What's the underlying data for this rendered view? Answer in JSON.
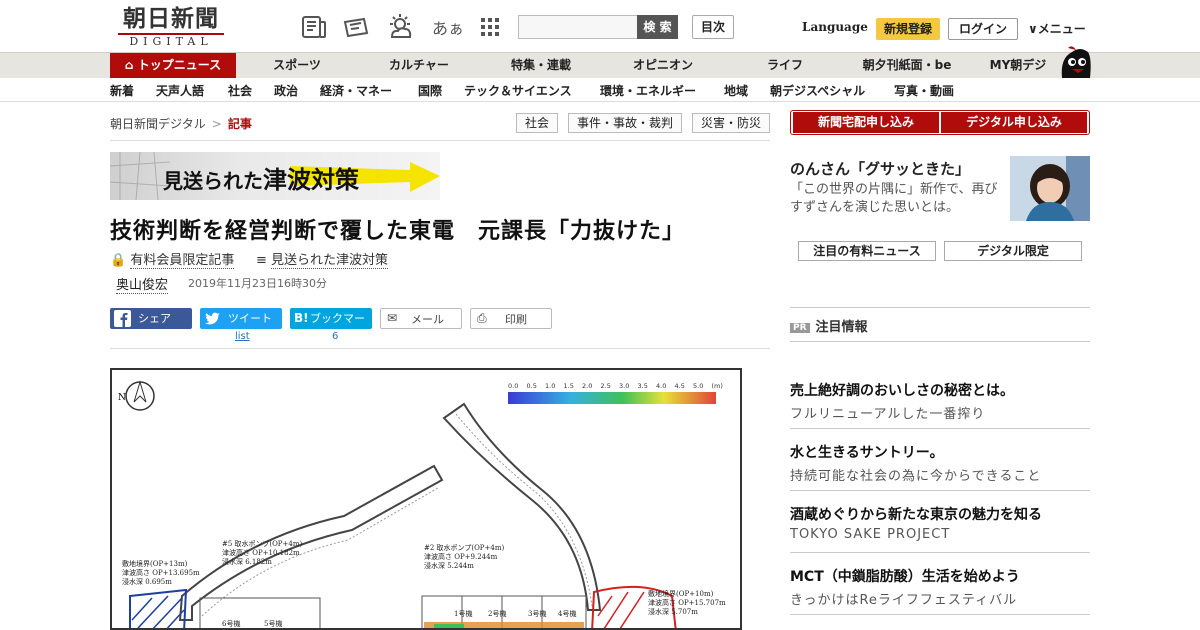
{
  "header": {
    "logo_jp": "朝日新聞",
    "logo_en": "DIGITAL",
    "font_toggle": "あぁ",
    "search_placeholder": "",
    "search_label": "検 索",
    "index_label": "目次",
    "language_label": "Language",
    "register_label": "新規登録",
    "login_label": "ログイン",
    "menu_label": "メニュー"
  },
  "nav_primary": [
    "トップニュース",
    "スポーツ",
    "カルチャー",
    "特集・連載",
    "オピニオン",
    "ライフ",
    "朝夕刊紙面・be",
    "MY朝デジ"
  ],
  "nav_secondary": [
    "新着",
    "天声人語",
    "社会",
    "政治",
    "経済・マネー",
    "国際",
    "テック＆サイエンス",
    "環境・エネルギー",
    "地域",
    "朝デジスペシャル",
    "写真・動画"
  ],
  "breadcrumb": {
    "home": "朝日新聞デジタル",
    "separator": ">",
    "current": "記事"
  },
  "tags": [
    "社会",
    "事件・事故・裁判",
    "災害・防災"
  ],
  "banner": {
    "prefix": "見送られた",
    "main": "津波対策"
  },
  "article": {
    "headline": "技術判断を経営判断で覆した東電　元課長「力抜けた」",
    "paid_label": "有料会員限定記事",
    "series_label": "見送られた津波対策",
    "author": "奥山俊宏",
    "date": "2019年11月23日16時30分"
  },
  "share": {
    "facebook": "シェア",
    "twitter": "ツイート",
    "hatena": "ブックマーク",
    "mail": "メール",
    "print": "印刷",
    "twitter_count": "list",
    "hatena_count": "6"
  },
  "figure": {
    "scale_ticks": [
      "0.0",
      "0.5",
      "1.0",
      "1.5",
      "2.0",
      "2.5",
      "3.0",
      "3.5",
      "4.0",
      "4.5",
      "5.0",
      "(m)"
    ],
    "compass": "N",
    "labels": [
      [
        "#5 取水ポンプ(OP+4m)",
        "津波高さ OP+10.182m",
        "浸水深 6.182m"
      ],
      [
        "#2 取水ポンプ(OP+4m)",
        "津波高さ OP+9.244m",
        "浸水深 5.244m"
      ],
      [
        "敷地境界(OP+13m)",
        "津波高さ OP+13.695m",
        "浸水深 0.695m"
      ],
      [
        "敷地境界(OP+10m)",
        "津波高さ OP+15.707m",
        "浸水深 5.707m"
      ]
    ],
    "units": [
      "1号機",
      "2号機",
      "3号機",
      "4号機",
      "6号機",
      "5号機"
    ]
  },
  "sidebar": {
    "subscribe_paper": "新聞宅配申し込み",
    "subscribe_digital": "デジタル申し込み",
    "promo_title": "のんさん「グサッときた」",
    "promo_desc": "「この世界の片隅に」新作で、再びすずさんを演じた思いとは。",
    "tab_paid": "注目の有料ニュース",
    "tab_digital": "デジタル限定",
    "pr_badge": "PR",
    "pr_heading": "注目情報",
    "pr_items": [
      {
        "title": "売上絶好調のおいしさの秘密とは。",
        "sub": "フルリニューアルした一番搾り"
      },
      {
        "title": "水と生きるサントリー。",
        "sub": "持続可能な社会の為に今からできること"
      },
      {
        "title": "酒蔵めぐりから新たな東京の魅力を知る",
        "sub": "TOKYO SAKE PROJECT"
      },
      {
        "title": "MCT（中鎖脂肪酸）生活を始めよう",
        "sub": "きっかけはReライフフェスティバル"
      }
    ]
  },
  "colors": {
    "brand_red": "#b00c0c",
    "nav_bg": "#e7e5df",
    "register_yellow": "#f5c842",
    "facebook": "#3b5998",
    "twitter": "#1da1f2",
    "hatena": "#00a4de"
  }
}
